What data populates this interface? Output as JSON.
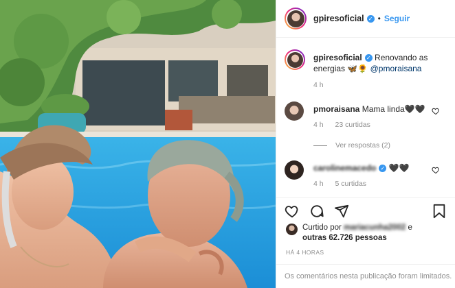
{
  "header": {
    "username": "gpiresoficial",
    "dot": "•",
    "follow_label": "Seguir"
  },
  "caption": {
    "username": "gpiresoficial",
    "text": "Renovando as energias 🦋🌻",
    "mention": "@pmoraisana",
    "time": "4 h"
  },
  "comments": [
    {
      "username": "pmoraisana",
      "text": "Mama linda🖤🖤",
      "time": "4 h",
      "likes": "23 curtidas",
      "replies": "Ver respostas (2)"
    },
    {
      "username": "carolinemacedo",
      "text": "🖤🖤",
      "time": "4 h",
      "likes": "5 curtidas"
    }
  ],
  "likes": {
    "prefix": "Curtido por",
    "user": "mariacunha2002",
    "and": "e",
    "others": "outras 62.726 pessoas"
  },
  "timestamp": "HÁ 4 HORAS",
  "limited_notice": "Os comentários nesta publicação foram limitados.",
  "icons": {
    "like": "heart-icon",
    "comment": "comment-icon",
    "share": "send-icon",
    "save": "bookmark-icon"
  },
  "colors": {
    "link_blue": "#3897f0",
    "secondary_text": "#8e8e8e",
    "mention": "#00376b"
  }
}
